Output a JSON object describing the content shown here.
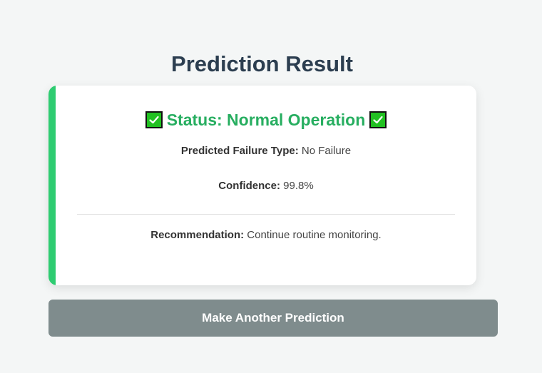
{
  "page": {
    "title": "Prediction Result"
  },
  "result": {
    "status_text": "Status: Normal Operation",
    "status_icon": "check-mark-icon",
    "failure_type_label": "Predicted Failure Type:",
    "failure_type_value": "No Failure",
    "confidence_label": "Confidence:",
    "confidence_value": "99.8%",
    "recommendation_label": "Recommendation:",
    "recommendation_value": "Continue routine monitoring."
  },
  "actions": {
    "new_prediction_label": "Make Another Prediction"
  },
  "colors": {
    "accent": "#2ecc71",
    "status_text": "#27ae60",
    "button": "#7f8c8d",
    "title": "#2c3e50"
  }
}
